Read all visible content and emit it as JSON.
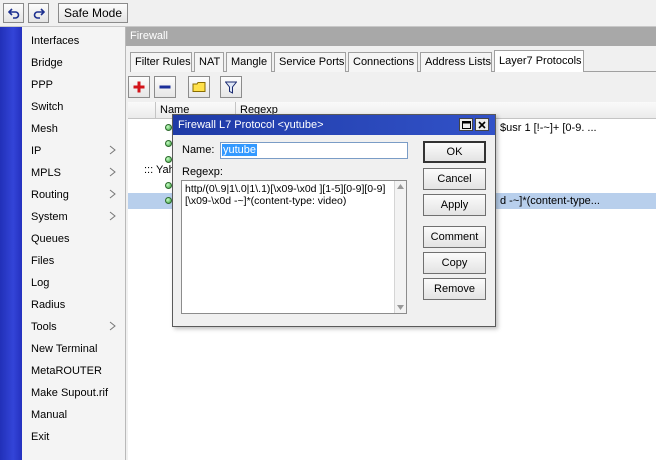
{
  "toolbar": {
    "undo_icon": "undo-icon",
    "redo_icon": "redo-icon",
    "safe_mode_label": "Safe Mode"
  },
  "sidebar": {
    "items": [
      {
        "label": "Interfaces",
        "submenu": false
      },
      {
        "label": "Bridge",
        "submenu": false
      },
      {
        "label": "PPP",
        "submenu": false
      },
      {
        "label": "Switch",
        "submenu": false
      },
      {
        "label": "Mesh",
        "submenu": false
      },
      {
        "label": "IP",
        "submenu": true
      },
      {
        "label": "MPLS",
        "submenu": true
      },
      {
        "label": "Routing",
        "submenu": true
      },
      {
        "label": "System",
        "submenu": true
      },
      {
        "label": "Queues",
        "submenu": false
      },
      {
        "label": "Files",
        "submenu": false
      },
      {
        "label": "Log",
        "submenu": false
      },
      {
        "label": "Radius",
        "submenu": false
      },
      {
        "label": "Tools",
        "submenu": true
      },
      {
        "label": "New Terminal",
        "submenu": false
      },
      {
        "label": "MetaROUTER",
        "submenu": false
      },
      {
        "label": "Make Supout.rif",
        "submenu": false
      },
      {
        "label": "Manual",
        "submenu": false
      },
      {
        "label": "Exit",
        "submenu": false
      }
    ]
  },
  "firewall": {
    "title": "Firewall",
    "tabs": [
      {
        "label": "Filter Rules"
      },
      {
        "label": "NAT"
      },
      {
        "label": "Mangle"
      },
      {
        "label": "Service Ports"
      },
      {
        "label": "Connections"
      },
      {
        "label": "Address Lists"
      },
      {
        "label": "Layer7 Protocols",
        "active": true
      }
    ],
    "tools": [
      "add-icon",
      "remove-icon",
      "comment-icon",
      "filter-icon"
    ],
    "table": {
      "columns": [
        "Name",
        "Regexp"
      ],
      "rows": [
        {
          "type": "entry",
          "regexp": "$usr 1 [!-~]+ [0-9. ..."
        },
        {
          "type": "entry",
          "regexp": ""
        },
        {
          "type": "entry",
          "regexp": ""
        },
        {
          "type": "comment",
          "text": "::: Yah"
        },
        {
          "type": "entry",
          "regexp": ""
        },
        {
          "type": "entry",
          "selected": true,
          "regexp": "d -~]*(content-type..."
        }
      ]
    }
  },
  "dialog": {
    "title": "Firewall L7 Protocol <yutube>",
    "name_label": "Name:",
    "name_value": "yutube",
    "regexp_label": "Regexp:",
    "regexp_value": "http/(0\\.9|1\\.0|1\\.1)[\\x09-\\x0d ][1-5][0-9][0-9][\\x09-\\x0d -~]*(content-type: video)",
    "buttons": {
      "ok": "OK",
      "cancel": "Cancel",
      "apply": "Apply",
      "comment": "Comment",
      "copy": "Copy",
      "remove": "Remove"
    }
  }
}
